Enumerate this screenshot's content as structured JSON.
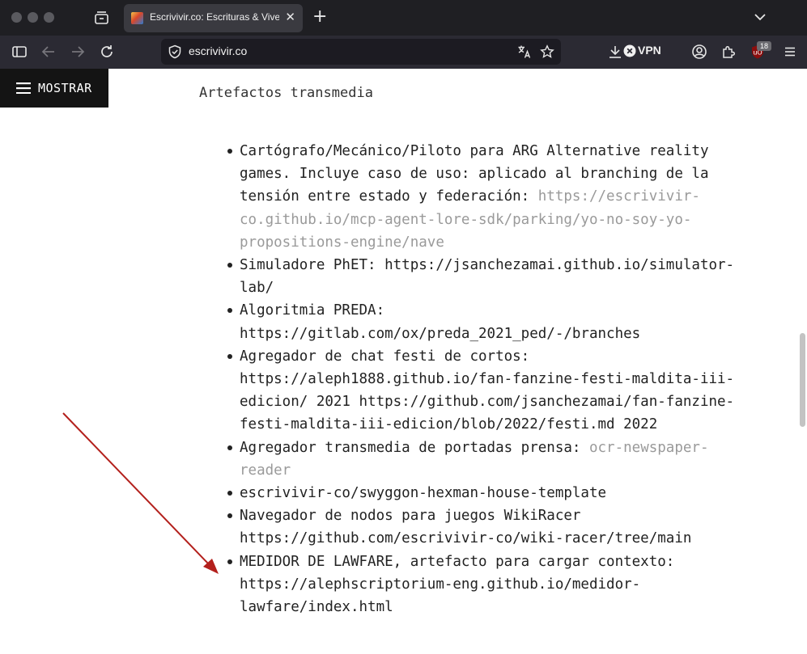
{
  "browser": {
    "tab": {
      "title": "Escrivivir.co: Escrituras & Vivencias"
    },
    "url": "escrivivir.co",
    "vpn_label": "VPN",
    "extension_badge": "18"
  },
  "colors": {
    "chrome_dark": "#1f1f23",
    "toolbar": "#2b2a33",
    "annotation_arrow": "#b3201c",
    "link_muted": "#9a9a9a"
  },
  "page": {
    "menu_label": "MOSTRAR",
    "section_title": "Artefactos transmedia",
    "items": [
      {
        "text": "Cartógrafo/Mecánico/Piloto para ARG Alternative reality games. Incluye caso de uso: aplicado al branching de la tensión entre estado y federación: ",
        "link": "https://escrivivir-co.github.io/mcp-agent-lore-sdk/parking/yo-no-soy-yo-propositions-engine/nave"
      },
      {
        "text": "Simuladore PhET: https://jsanchezamai.github.io/simulator-lab/"
      },
      {
        "text": "Algoritmia PREDA: https://gitlab.com/ox/preda_2021_ped/-/branches"
      },
      {
        "text": "Agregador de chat festi de cortos: https://aleph1888.github.io/fan-fanzine-festi-maldita-iii-edicion/ 2021 https://github.com/jsanchezamai/fan-fanzine-festi-maldita-iii-edicion/blob/2022/festi.md 2022"
      },
      {
        "text": "Agregador transmedia de portadas prensa: ",
        "link": "ocr-newspaper-reader"
      },
      {
        "text": "escrivivir-co/swyggon-hexman-house-template"
      },
      {
        "text": "Navegador de nodos para juegos WikiRacer https://github.com/escrivivir-co/wiki-racer/tree/main"
      },
      {
        "text": "MEDIDOR DE LAWFARE, artefacto para cargar contexto: https://alephscriptorium-eng.github.io/medidor-lawfare/index.html"
      }
    ]
  }
}
